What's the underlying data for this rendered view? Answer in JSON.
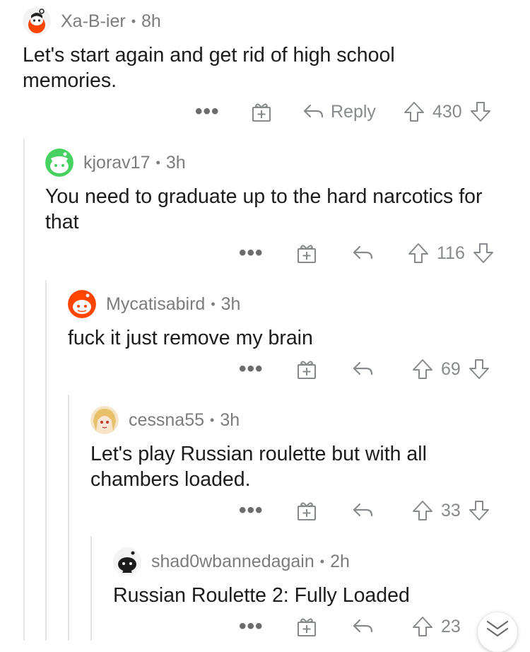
{
  "comments": [
    {
      "author": "Xa-B-ier",
      "age": "8h",
      "text": "Let's start again and get rid of high school memories.",
      "votes": "430",
      "reply_label": "Reply"
    },
    {
      "author": "kjorav17",
      "age": "3h",
      "text": "You need to graduate up to the hard narcotics for that",
      "votes": "116"
    },
    {
      "author": "Mycatisabird",
      "age": "3h",
      "text": "fuck it just remove my brain",
      "votes": "69"
    },
    {
      "author": "cessna55",
      "age": "3h",
      "text": "Let's play Russian roulette but with all chambers loaded.",
      "votes": "33"
    },
    {
      "author": "shad0wbannedagain",
      "age": "2h",
      "text": "Russian Roulette 2: Fully Loaded",
      "votes": "23"
    }
  ],
  "meta_separator": "•",
  "more_glyph": "•••",
  "colors": {
    "meta": "#7c7c7c",
    "icon": "#878a8c",
    "thread_line": "#e6e6e6",
    "avatar_orange": "#ff4500",
    "avatar_green": "#46d160"
  }
}
